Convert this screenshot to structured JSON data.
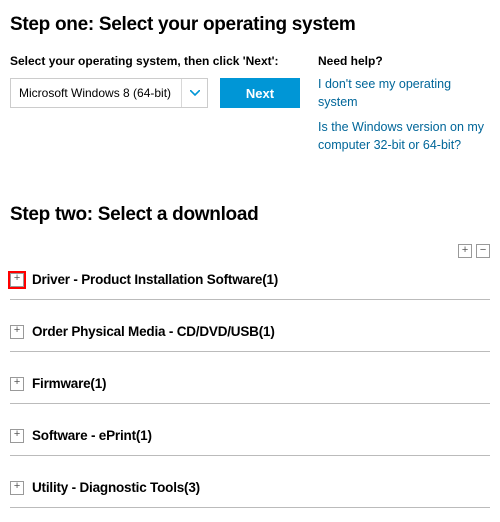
{
  "step1": {
    "title": "Step one: Select your operating system",
    "label": "Select your operating system, then click 'Next':",
    "selected_os": "Microsoft Windows 8 (64-bit)",
    "next_label": "Next"
  },
  "help": {
    "title": "Need help?",
    "link1": "I don't see my operating system",
    "link2": "Is the Windows version on my computer 32-bit or 64-bit?"
  },
  "step2": {
    "title": "Step two: Select a download",
    "items": [
      {
        "label": "Driver - Product Installation Software(1)"
      },
      {
        "label": "Order Physical Media - CD/DVD/USB(1)"
      },
      {
        "label": "Firmware(1)"
      },
      {
        "label": "Software - ePrint(1)"
      },
      {
        "label": "Utility - Diagnostic Tools(3)"
      }
    ]
  },
  "glyphs": {
    "plus": "+",
    "minus": "−"
  }
}
